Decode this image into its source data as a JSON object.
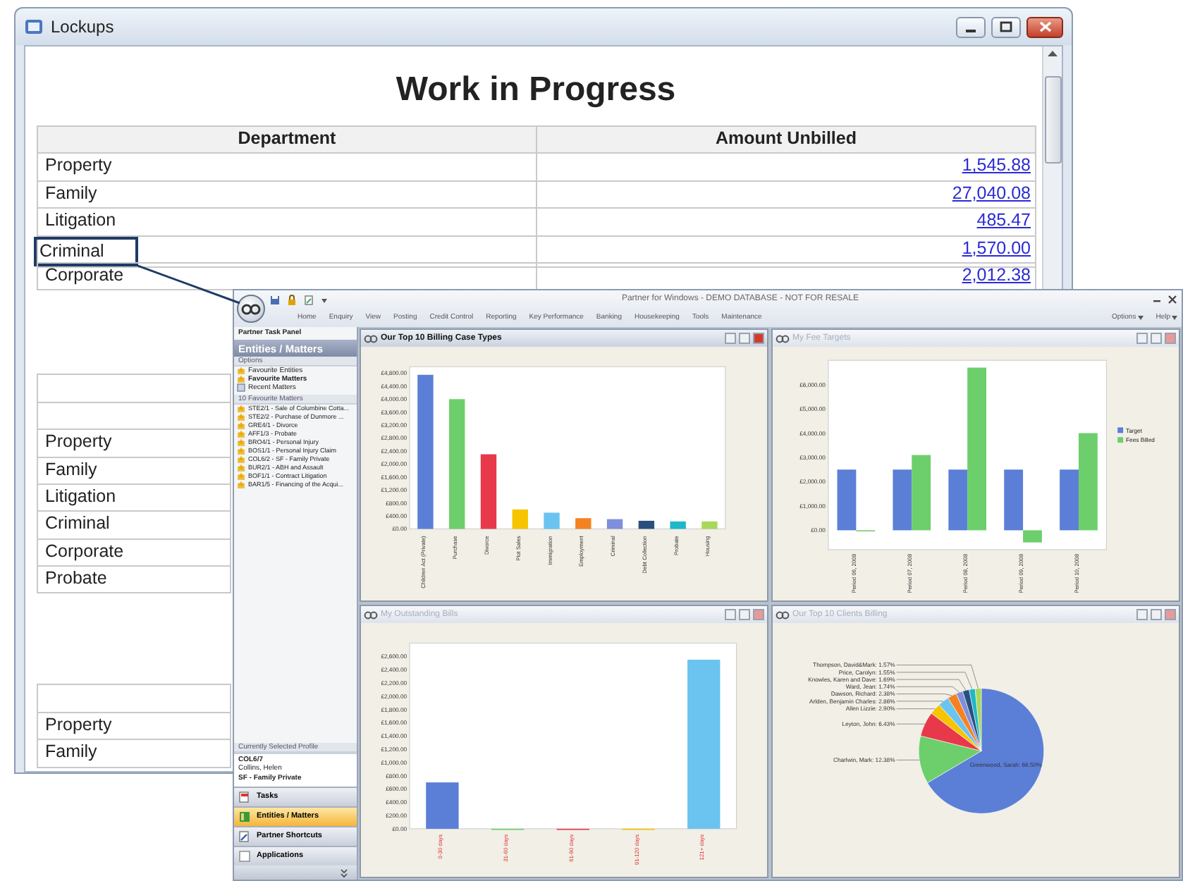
{
  "lockups_window": {
    "title": "Lockups",
    "heading": "Work in Progress",
    "columns": [
      "Department",
      "Amount Unbilled"
    ],
    "rows": [
      {
        "department": "Property",
        "amount": "1,545.88",
        "highlighted": false
      },
      {
        "department": "Family",
        "amount": "27,040.08",
        "highlighted": false
      },
      {
        "department": "Litigation",
        "amount": "485.47",
        "highlighted": false
      },
      {
        "department": "Criminal",
        "amount": "1,570.00",
        "highlighted": true
      },
      {
        "department": "Corporate",
        "amount": "2,012.38",
        "highlighted": false
      }
    ],
    "continued_groups": [
      {
        "departments": [
          "Property",
          "Family",
          "Litigation",
          "Criminal",
          "Corporate",
          "Probate"
        ]
      },
      {
        "departments": [
          "Property",
          "Family"
        ]
      }
    ]
  },
  "partner_window": {
    "title": "Partner for Windows - DEMO DATABASE - NOT FOR RESALE",
    "menu": [
      "Home",
      "Enquiry",
      "View",
      "Posting",
      "Credit Control",
      "Reporting",
      "Key Performance",
      "Banking",
      "Housekeeping",
      "Tools",
      "Maintenance"
    ],
    "menu_right": [
      "Options",
      "Help"
    ],
    "task_panel": {
      "title": "Partner Task Panel",
      "section": "Entities / Matters",
      "options_header": "Options",
      "options": [
        {
          "label": "Favourite Entities",
          "selected": false
        },
        {
          "label": "Favourite Matters",
          "selected": true
        },
        {
          "label": "Recent Matters",
          "selected": false
        }
      ],
      "favourites_header": "10 Favourite Matters",
      "favourites": [
        "STE2/1 - Sale of Columbine Cotta...",
        "STE2/2 - Purchase of Dunmore ...",
        "GRE4/1 - Divorce",
        "AFF1/3 - Probate",
        "BRO4/1 - Personal Injury",
        "BOS1/1 - Personal Injury Claim",
        "COL6/2 - SF - Family Private",
        "BUR2/1 - ABH and Assault",
        "BOF1/1 - Contract Litigation",
        "BAR1/5 - Financing of the Acqui..."
      ],
      "profile_header": "Currently Selected Profile",
      "profile": [
        "COL6/7",
        "Collins, Helen",
        "SF - Family Private"
      ],
      "nav": [
        {
          "label": "Tasks",
          "selected": false
        },
        {
          "label": "Entities / Matters",
          "selected": true
        },
        {
          "label": "Partner Shortcuts",
          "selected": false
        },
        {
          "label": "Applications",
          "selected": false
        }
      ]
    },
    "panes": [
      {
        "title": "Our Top 10 Billing Case Types",
        "active": true,
        "chart_data": {
          "type": "bar",
          "stacked": true,
          "categories": [
            "Children Act (Private)",
            "Purchase",
            "Divorce",
            "Plot Sales",
            "Immigration",
            "Employment",
            "Criminal",
            "Debt Collection",
            "Probate",
            "Housing"
          ],
          "series": [
            {
              "color": "#5b7fd6",
              "values": [
                4750,
                null,
                null,
                null,
                null,
                null,
                null,
                null,
                null,
                null
              ]
            },
            {
              "color": "#6ccf6c",
              "values": [
                null,
                4000,
                null,
                null,
                null,
                null,
                null,
                null,
                null,
                null
              ]
            },
            {
              "color": "#e8394a",
              "values": [
                null,
                null,
                2300,
                null,
                null,
                null,
                null,
                null,
                null,
                null
              ]
            },
            {
              "color": "#f6c500",
              "values": [
                null,
                null,
                null,
                600,
                null,
                null,
                null,
                null,
                null,
                null
              ]
            },
            {
              "color": "#6bc3f0",
              "values": [
                null,
                null,
                null,
                null,
                500,
                null,
                null,
                null,
                null,
                null
              ]
            },
            {
              "color": "#f58220",
              "values": [
                null,
                null,
                null,
                null,
                null,
                330,
                null,
                null,
                null,
                null
              ]
            },
            {
              "color": "#7f8fdc",
              "values": [
                null,
                null,
                null,
                null,
                null,
                null,
                300,
                null,
                null,
                null
              ]
            },
            {
              "color": "#2a4f7f",
              "values": [
                null,
                null,
                null,
                null,
                null,
                null,
                null,
                250,
                null,
                null
              ]
            },
            {
              "color": "#1fb8c8",
              "values": [
                null,
                null,
                null,
                null,
                null,
                null,
                null,
                null,
                230,
                null
              ]
            },
            {
              "color": "#a8d85a",
              "values": [
                null,
                null,
                null,
                null,
                null,
                null,
                null,
                null,
                null,
                230
              ]
            }
          ],
          "ylim": [
            0,
            5000
          ],
          "yticks": [
            {
              "value": 0,
              "label": "£0.00"
            },
            {
              "value": 400,
              "label": "£400.00"
            },
            {
              "value": 800,
              "label": "£800.00"
            },
            {
              "value": 1200,
              "label": "£1,200.00"
            },
            {
              "value": 1600,
              "label": "£1,600.00"
            },
            {
              "value": 2000,
              "label": "£2,000.00"
            },
            {
              "value": 2400,
              "label": "£2,400.00"
            },
            {
              "value": 2800,
              "label": "£2,800.00"
            },
            {
              "value": 3200,
              "label": "£3,200.00"
            },
            {
              "value": 3600,
              "label": "£3,600.00"
            },
            {
              "value": 4000,
              "label": "£4,000.00"
            },
            {
              "value": 4400,
              "label": "£4,400.00"
            },
            {
              "value": 4800,
              "label": "£4,800.00"
            }
          ]
        }
      },
      {
        "title": "My Fee Targets",
        "active": false,
        "chart_data": {
          "type": "bar",
          "legend": "right",
          "categories": [
            "Period 06, 2008",
            "Period 07, 2008",
            "Period 08, 2008",
            "Period 09, 2008",
            "Period 10, 2008"
          ],
          "series": [
            {
              "name": "Target",
              "color": "#5b7fd6",
              "values": [
                2500,
                2500,
                2500,
                2500,
                2500
              ]
            },
            {
              "name": "Fees Billed",
              "color": "#6ccf6c",
              "values": [
                0,
                3100,
                6700,
                -500,
                4000
              ]
            }
          ],
          "ylim": [
            -800,
            7000
          ],
          "yticks": [
            {
              "value": 0,
              "label": "£0.00"
            },
            {
              "value": 1000,
              "label": "£1,000.00"
            },
            {
              "value": 2000,
              "label": "£2,000.00"
            },
            {
              "value": 3000,
              "label": "£3,000.00"
            },
            {
              "value": 4000,
              "label": "£4,000.00"
            },
            {
              "value": 5000,
              "label": "£5,000.00"
            },
            {
              "value": 6000,
              "label": "£6,000.00"
            }
          ]
        }
      },
      {
        "title": "My Outstanding Bills",
        "active": false,
        "chart_data": {
          "type": "bar",
          "stacked": true,
          "categories": [
            "0-30 days",
            "31-60 days",
            "61-90 days",
            "91-120 days",
            "121+ days"
          ],
          "series": [
            {
              "color": "#5b7fd6",
              "values": [
                700,
                null,
                null,
                null,
                null
              ]
            },
            {
              "color": "#6ccf6c",
              "values": [
                null,
                0,
                null,
                null,
                null
              ]
            },
            {
              "color": "#e8394a",
              "values": [
                null,
                null,
                0,
                null,
                null
              ]
            },
            {
              "color": "#f6c500",
              "values": [
                null,
                null,
                null,
                0,
                null
              ]
            },
            {
              "color": "#6bc3f0",
              "values": [
                null,
                null,
                null,
                null,
                2550
              ]
            }
          ],
          "ylim": [
            0,
            2800
          ],
          "yticks": [
            {
              "value": 0,
              "label": "£0.00"
            },
            {
              "value": 200,
              "label": "£200.00"
            },
            {
              "value": 400,
              "label": "£400.00"
            },
            {
              "value": 600,
              "label": "£600.00"
            },
            {
              "value": 800,
              "label": "£800.00"
            },
            {
              "value": 1000,
              "label": "£1,000.00"
            },
            {
              "value": 1200,
              "label": "£1,200.00"
            },
            {
              "value": 1400,
              "label": "£1,400.00"
            },
            {
              "value": 1600,
              "label": "£1,600.00"
            },
            {
              "value": 1800,
              "label": "£1,800.00"
            },
            {
              "value": 2000,
              "label": "£2,000.00"
            },
            {
              "value": 2200,
              "label": "£2,200.00"
            },
            {
              "value": 2400,
              "label": "£2,400.00"
            },
            {
              "value": 2600,
              "label": "£2,600.00"
            }
          ]
        }
      },
      {
        "title": "Our Top 10 Clients Billing",
        "active": false,
        "chart_data": {
          "type": "pie",
          "values": [
            66.5,
            12.38,
            6.43,
            2.9,
            2.86,
            2.38,
            1.74,
            1.69,
            1.55,
            1.57
          ],
          "colors": [
            "#5b7fd6",
            "#6ccf6c",
            "#e8394a",
            "#f6c500",
            "#6bc3f0",
            "#f58220",
            "#7f8fdc",
            "#2a4f7f",
            "#1fb8c8",
            "#a8d85a"
          ],
          "value_labels": [
            "Greenwood, Sarah: 66.50%",
            "Charlwin, Mark: 12.38%",
            "Leyton, John: 6.43%",
            "Allen Lizzie: 2.90%",
            "Arlden, Benjamin Charles: 2.86%",
            "Dawson, Richard: 2.38%",
            "Ward, Jean: 1.74%",
            "Knowles, Karen and Dave: 1.69%",
            "Price, Carolyn: 1.55%",
            "Thompson, David&Mark: 1.57%"
          ]
        }
      }
    ]
  }
}
